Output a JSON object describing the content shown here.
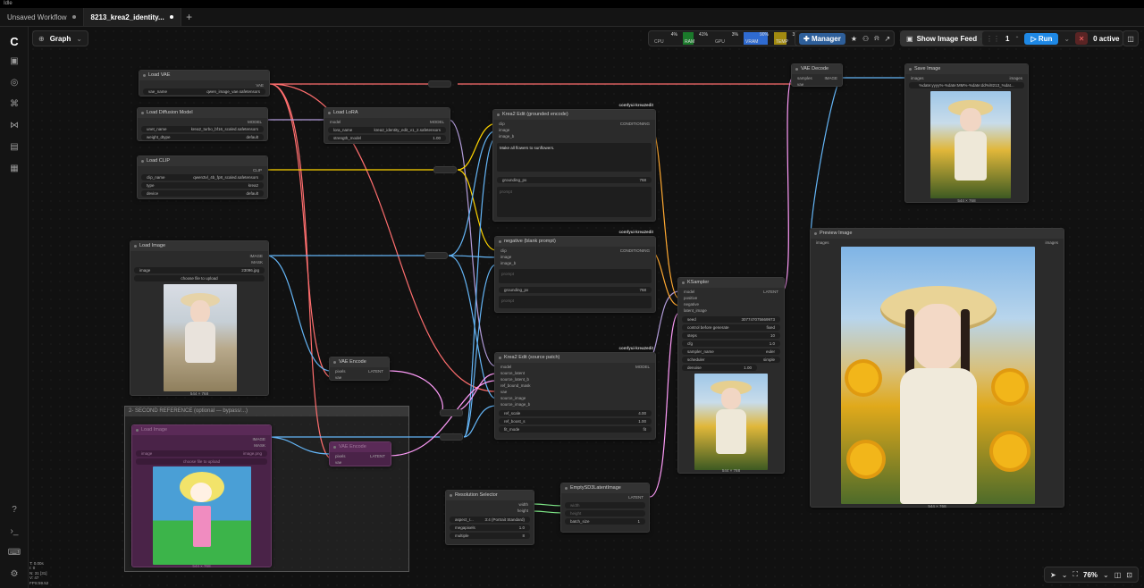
{
  "titlebar": {
    "label": "Idle"
  },
  "tabs": [
    {
      "label": "Unsaved Workflow",
      "active": false
    },
    {
      "label": "8213_krea2_identity...",
      "active": true
    }
  ],
  "toolbar": {
    "mode": "Graph",
    "cpu": {
      "label": "CPU",
      "value": "4%"
    },
    "ram": {
      "label": "RAM",
      "value": "41%"
    },
    "gpu": {
      "label": "GPU",
      "value": "3%"
    },
    "vram": {
      "label": "VRAM",
      "value": "90%"
    },
    "temp": {
      "label": "TEMP",
      "value": "32°"
    },
    "manager": "Manager",
    "show_feed": "Show Image Feed",
    "queue_count": "1",
    "run": "Run",
    "active": "0 active"
  },
  "nodes": {
    "load_vae": {
      "title": "Load VAE",
      "out": "VAE",
      "w_label": "vae_name",
      "w_value": "qwen_image_vae.safetensors"
    },
    "load_diffusion": {
      "title": "Load Diffusion Model",
      "out": "MODEL",
      "w1_label": "unet_name",
      "w1_value": "krea2_turbo_bf16_scaled.safetensors",
      "w2_label": "weight_dtype",
      "w2_value": "default"
    },
    "load_lora": {
      "title": "Load LoRA",
      "in": "model",
      "out": "MODEL",
      "w1_label": "lora_name",
      "w1_value": "krea2_identity_edit_v1_2.safetensors",
      "w2_label": "strength_model",
      "w2_value": "1.00"
    },
    "load_clip": {
      "title": "Load CLIP",
      "out": "CLIP",
      "w1_label": "clip_name",
      "w1_value": "qwen3vl_4b_fp8_scaled.safetensors",
      "w2_label": "type",
      "w2_value": "krea2",
      "w3_label": "device",
      "w3_value": "default"
    },
    "load_image": {
      "title": "Load Image",
      "out1": "IMAGE",
      "out2": "MASK",
      "w_label": "image",
      "w_value": "23096.jpg",
      "upload": "choose file to upload",
      "size": "544 × 768"
    },
    "encode_pos": {
      "title": "Krea2 Edit (grounded encode)",
      "tag": "comfyui-krea2edit",
      "in1": "clip",
      "in2": "image",
      "in3": "image_b",
      "out": "CONDITIONING",
      "prompt": "Make all flowers to sunflowers.",
      "w_label": "grounding_px",
      "w_value": "768",
      "sub": "prompt"
    },
    "encode_neg": {
      "title": "negative (blank prompt)",
      "tag": "comfyui-krea2edit",
      "in1": "clip",
      "in2": "image",
      "in3": "image_b",
      "out": "CONDITIONING",
      "sub": "prompt",
      "w_label": "grounding_px",
      "w_value": "768"
    },
    "vae_encode": {
      "title": "VAE Encode",
      "in1": "pixels",
      "in2": "vae",
      "out": "LATENT"
    },
    "source_patch": {
      "title": "Krea2 Edit (source patch)",
      "tag": "comfyui-krea2edit",
      "in1": "model",
      "in2": "source_latent",
      "in3": "source_latent_b",
      "in4": "ref_bound_mask",
      "in5": "vae",
      "in6": "source_image",
      "in7": "source_image_b",
      "out": "MODEL",
      "w1_label": "ref_scale",
      "w1_value": "4.00",
      "w2_label": "ref_boost_s",
      "w2_value": "1.00",
      "w3_label": "fit_mode",
      "w3_value": "fit"
    },
    "ksampler": {
      "title": "KSampler",
      "in1": "model",
      "in2": "positive",
      "in3": "negative",
      "in4": "latent_image",
      "out": "LATENT",
      "w1_label": "seed",
      "w1_value": "307747075669973",
      "w2_label": "control before generate",
      "w2_value": "fixed",
      "w3_label": "steps",
      "w3_value": "10",
      "w4_label": "cfg",
      "w4_value": "1.0",
      "w5_label": "sampler_name",
      "w5_value": "euler",
      "w6_label": "scheduler",
      "w6_value": "simple",
      "w7_label": "denoise",
      "w7_value": "1.00",
      "size": "544 × 768"
    },
    "vae_decode": {
      "title": "VAE Decode",
      "in1": "samples",
      "in2": "vae",
      "out": "IMAGE"
    },
    "save_image": {
      "title": "Save Image",
      "in": "images",
      "out": "images",
      "w_value": "%date:yyyy%-%date:MM%-%date:dd%/8213_%dat...",
      "size": "544 × 768"
    },
    "preview_image": {
      "title": "Preview Image",
      "in": "images",
      "out": "images",
      "size": "544 × 768"
    },
    "res_selector": {
      "title": "Resolution Selector",
      "out1": "width",
      "out2": "height",
      "w1_label": "aspect_r...",
      "w1_value": "3:4 (Portrait Standard)",
      "w2_label": "megapixels",
      "w2_value": "1.0",
      "w3_label": "multiple",
      "w3_value": "8"
    },
    "empty_latent": {
      "title": "EmptySD3LatentImage",
      "out": "LATENT",
      "in1": "width",
      "in2": "height",
      "w_label": "batch_size",
      "w_value": "1"
    },
    "second_group": {
      "title": "2- SECOND REFERENCE (optional — bypass/...)"
    },
    "load_image_2": {
      "title": "Load Image",
      "out1": "IMAGE",
      "out2": "MASK",
      "w_label": "image",
      "w_value": "image.png",
      "upload": "choose file to upload",
      "size": "544 × 768"
    },
    "vae_encode_2": {
      "title": "VAE Encode",
      "in1": "pixels",
      "in2": "vae",
      "out": "LATENT"
    }
  },
  "bottom": {
    "zoom": "76%"
  },
  "stats": [
    "T: 0.00s",
    "I: 0",
    "N: 31 [31]",
    "V: 47",
    "FPS:59.52"
  ],
  "colors": {
    "vae": "#ff6e6e",
    "clip": "#ffd500",
    "model": "#b39ddb",
    "image": "#64b5f6",
    "latent": "#ff9cf9",
    "cond": "#ffa931",
    "int": "#7ee787",
    "accent": "#2e8bdc"
  }
}
